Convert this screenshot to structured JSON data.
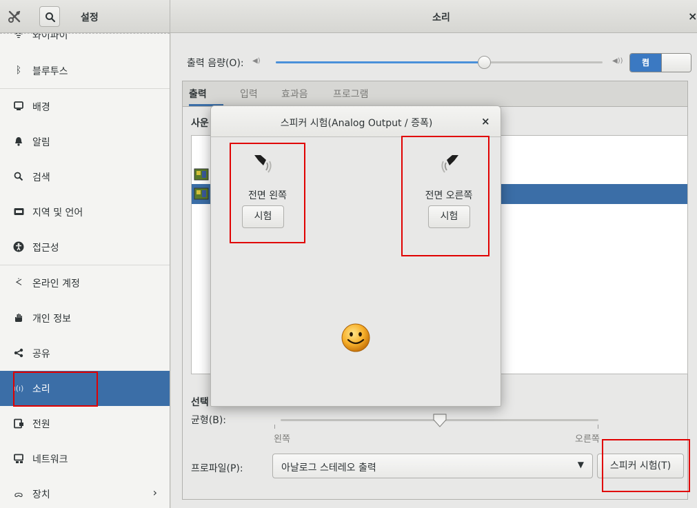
{
  "header": {
    "settings_title": "설정",
    "panel_title": "소리",
    "close_glyph": "×",
    "tools_icon": "tools-icon",
    "search_icon": "search-icon"
  },
  "sidebar": {
    "items": [
      {
        "label": "와이파이",
        "icon": "wifi-icon"
      },
      {
        "label": "블루투스",
        "icon": "bluetooth-icon"
      },
      {
        "label": "배경",
        "icon": "display-icon"
      },
      {
        "label": "알림",
        "icon": "bell-icon"
      },
      {
        "label": "검색",
        "icon": "search-icon"
      },
      {
        "label": "지역 및 언어",
        "icon": "keyboard-icon"
      },
      {
        "label": "접근성",
        "icon": "accessibility-icon"
      },
      {
        "label": "온라인 계정",
        "icon": "online-accounts-icon"
      },
      {
        "label": "개인 정보",
        "icon": "hand-icon"
      },
      {
        "label": "공유",
        "icon": "share-icon"
      },
      {
        "label": "소리",
        "icon": "speaker-icon",
        "active": true
      },
      {
        "label": "전원",
        "icon": "power-icon"
      },
      {
        "label": "네트워크",
        "icon": "network-icon"
      },
      {
        "label": "장치",
        "icon": "devices-icon",
        "chevron": "›"
      }
    ]
  },
  "main": {
    "volume_label": "출력 음량(O):",
    "volume_level": 0.64,
    "toggle_label": "켬",
    "tabs": [
      {
        "label": "출력",
        "active": true
      },
      {
        "label": "입력"
      },
      {
        "label": "효과음"
      },
      {
        "label": "프로그램"
      }
    ],
    "device_section_partial": "사운",
    "settings_section_partial": "선택",
    "balance_label": "균형(B):",
    "balance_level": 0.5,
    "balance_left": "왼쪽",
    "balance_right": "오른쪽",
    "profile_label": "프로파일(P):",
    "profile_value": "아날로그 스테레오 출력",
    "test_button": "스피커 시험(T)"
  },
  "dialog": {
    "title": "스피커 시험(Analog Output / 증폭)",
    "close_glyph": "×",
    "left_label": "전면 왼쪽",
    "left_button": "시험",
    "right_label": "전면 오른쪽",
    "right_button": "시험",
    "center_icon": "smiley-face-icon"
  },
  "colors": {
    "accent": "#3b6ea7",
    "annotation_red": "#e00000"
  }
}
